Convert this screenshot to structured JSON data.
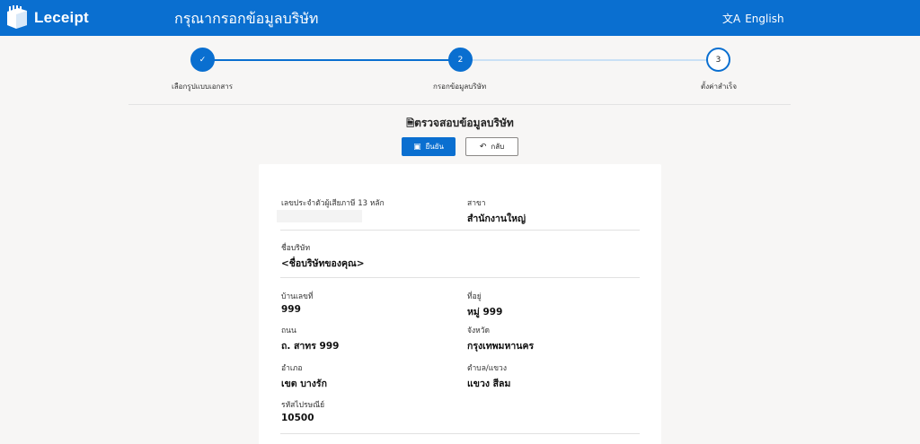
{
  "header": {
    "brand": "Leceipt",
    "title": "กรุณากรอกข้อมูลบริษัท",
    "language": "English",
    "language_icon": "translate-icon"
  },
  "stepper": {
    "steps": [
      {
        "label": "เลือกรูปแบบเอกสาร",
        "number": "✓",
        "state": "done"
      },
      {
        "label": "กรอกข้อมูลบริษัท",
        "number": "2",
        "state": "active"
      },
      {
        "label": "ตั้งค่าสำเร็จ",
        "number": "3",
        "state": "todo"
      }
    ]
  },
  "section": {
    "title": "ตรวจสอบข้อมูลบริษัท",
    "title_icon": "document-icon",
    "confirm_label": "ยืนยัน",
    "confirm_icon": "save-icon",
    "back_label": "กลับ",
    "back_icon": "undo-icon"
  },
  "company": {
    "tax_id_label": "เลขประจำตัวผู้เสียภาษี 13 หลัก",
    "tax_id_value": "",
    "branch_label": "สาขา",
    "branch_value": "สำนักงานใหญ่",
    "name_label": "ชื่อบริษัท",
    "name_value": "<ชื่อบริษัทของคุณ>",
    "house_no_label": "บ้านเลขที่",
    "house_no_value": "999",
    "address_label": "ที่อยู่",
    "address_value": "หมู่ 999",
    "road_label": "ถนน",
    "road_value": "ถ. สาทร 999",
    "province_label": "จังหวัด",
    "province_value": " กรุงเทพมหานคร",
    "district_label": "อำเภอ",
    "district_value": "เขต บางรัก",
    "subdistrict_label": "ตำบล/แขวง",
    "subdistrict_value": "แขวง สีลม",
    "postcode_label": "รหัสไปรษณีย์",
    "postcode_value": "10500"
  },
  "colors": {
    "brand": "#0a6fd0",
    "background": "#f7f6f5"
  }
}
